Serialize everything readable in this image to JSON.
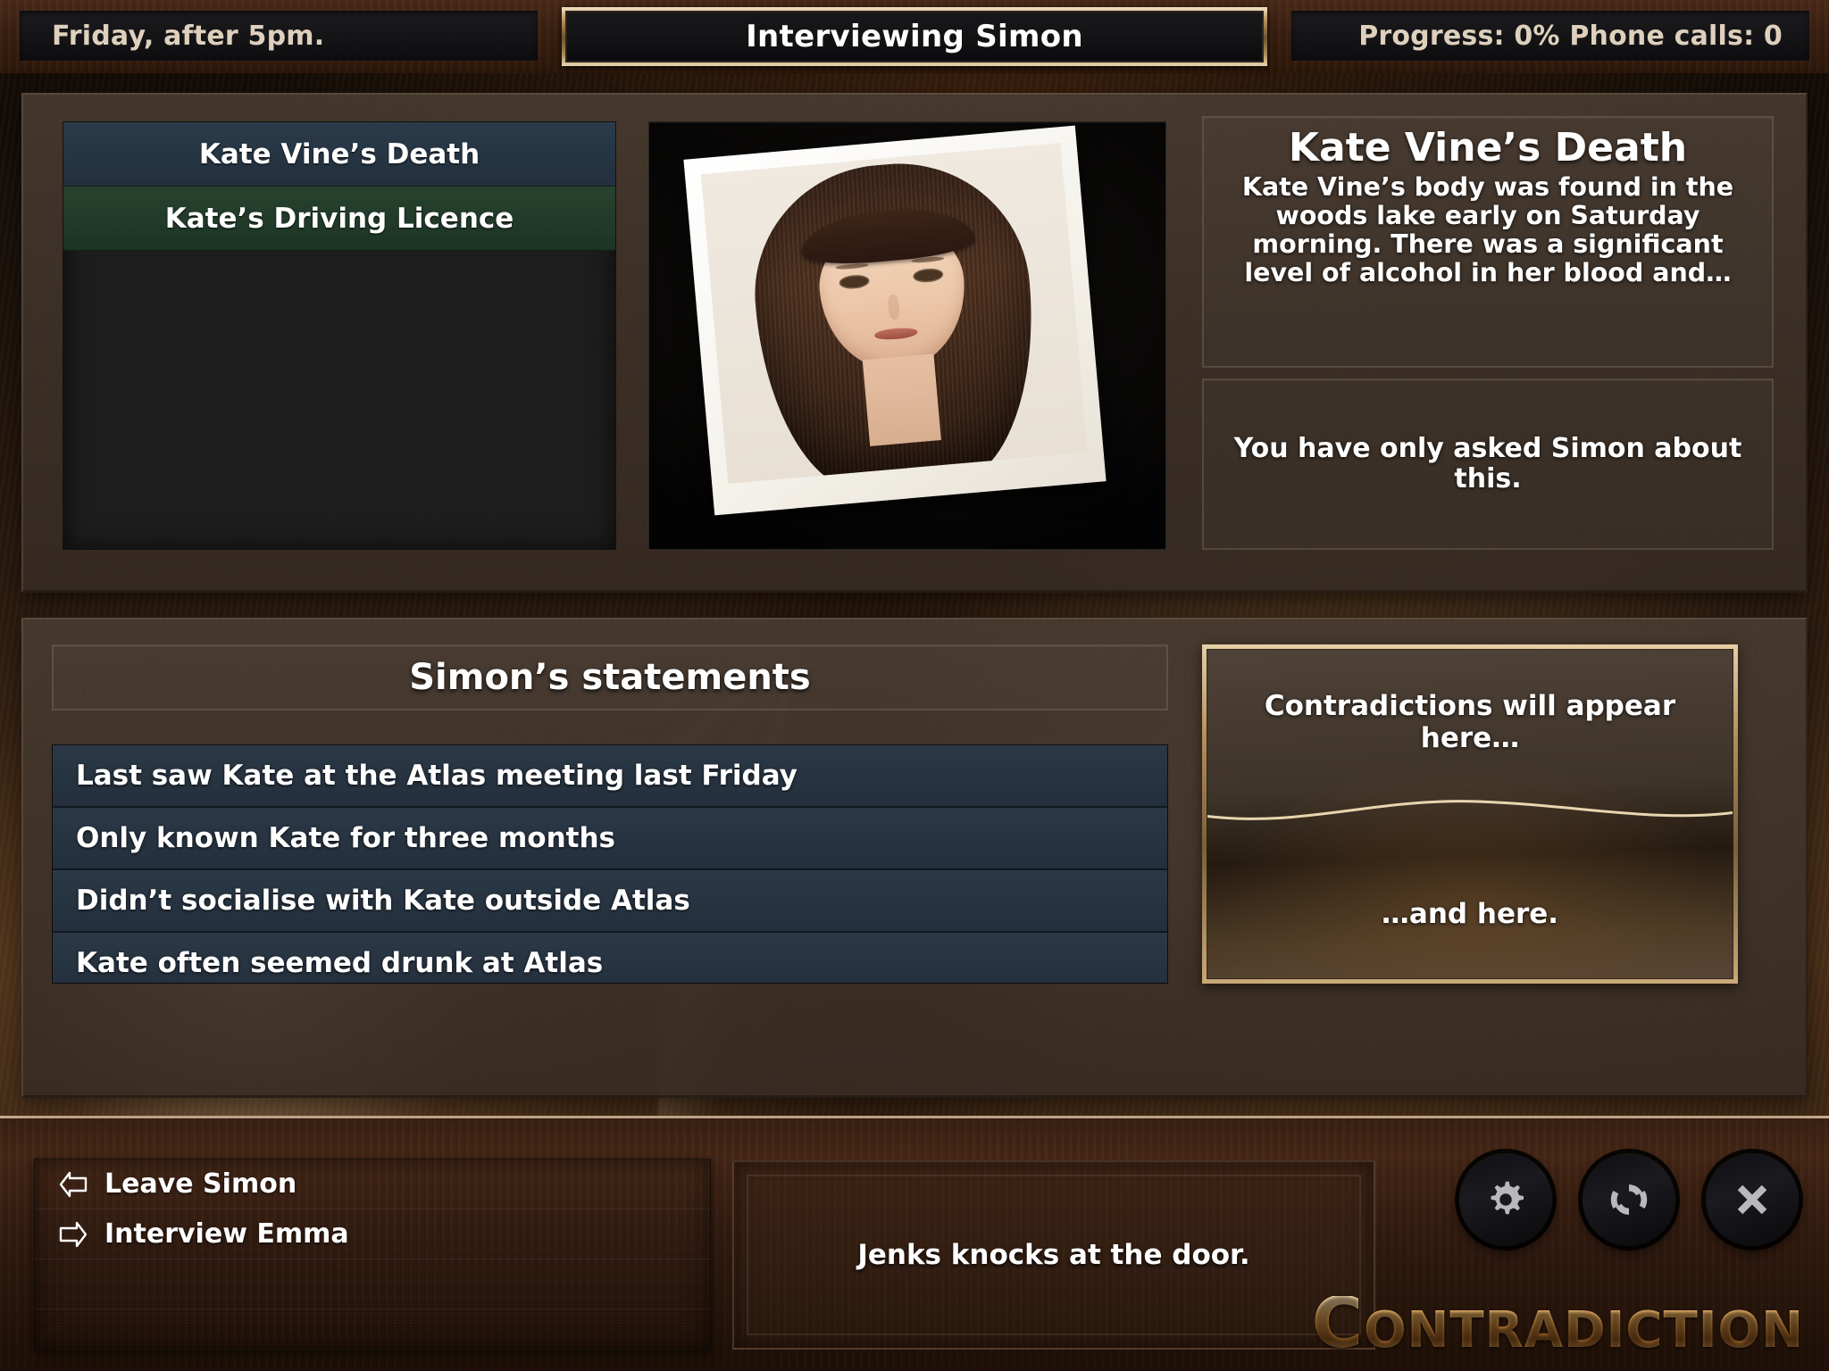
{
  "topbar": {
    "time_label": "Friday, after 5pm.",
    "title": "Interviewing Simon",
    "stats": "Progress: 0%  Phone calls: 0",
    "progress_percent": "0%",
    "phone_calls": "0"
  },
  "evidence": {
    "items": [
      {
        "label": "Kate Vine’s Death",
        "state": "navy"
      },
      {
        "label": "Kate’s Driving Licence",
        "state": "green"
      }
    ]
  },
  "photo": {
    "alt": "Kate Vine portrait photograph"
  },
  "case": {
    "title": "Kate Vine’s Death",
    "body": "Kate Vine’s body was found in the woods lake early on Saturday morning. There was a significant level of alcohol in her blood and…",
    "asked_status": "You have only asked Simon about this."
  },
  "statements": {
    "header": "Simon’s statements",
    "items": [
      "Last saw Kate at the Atlas meeting last Friday",
      "Only known Kate for three months",
      "Didn’t socialise with Kate outside Atlas",
      "Kate often seemed drunk at Atlas"
    ]
  },
  "contradictions": {
    "top_placeholder": "Contradictions will appear here…",
    "bottom_placeholder": "…and here."
  },
  "actions": {
    "items": [
      {
        "label": "Leave Simon",
        "icon": "arrow-left-icon"
      },
      {
        "label": "Interview Emma",
        "icon": "arrow-right-icon"
      }
    ]
  },
  "narration": {
    "text": "Jenks knocks at the door."
  },
  "buttons": [
    {
      "name": "settings-button",
      "icon": "gear-icon"
    },
    {
      "name": "replay-button",
      "icon": "refresh-icon"
    },
    {
      "name": "close-button",
      "icon": "close-x-icon"
    }
  ],
  "logo": {
    "first_letter": "C",
    "rest": "ONTRADICTION"
  },
  "colors": {
    "gold": "#c9a25c",
    "navy_row": "#263340",
    "green_row": "#1f3a28",
    "wood": "#3b2012",
    "panel_taupe": "#483b30",
    "tan_text": "#ded0bd"
  }
}
